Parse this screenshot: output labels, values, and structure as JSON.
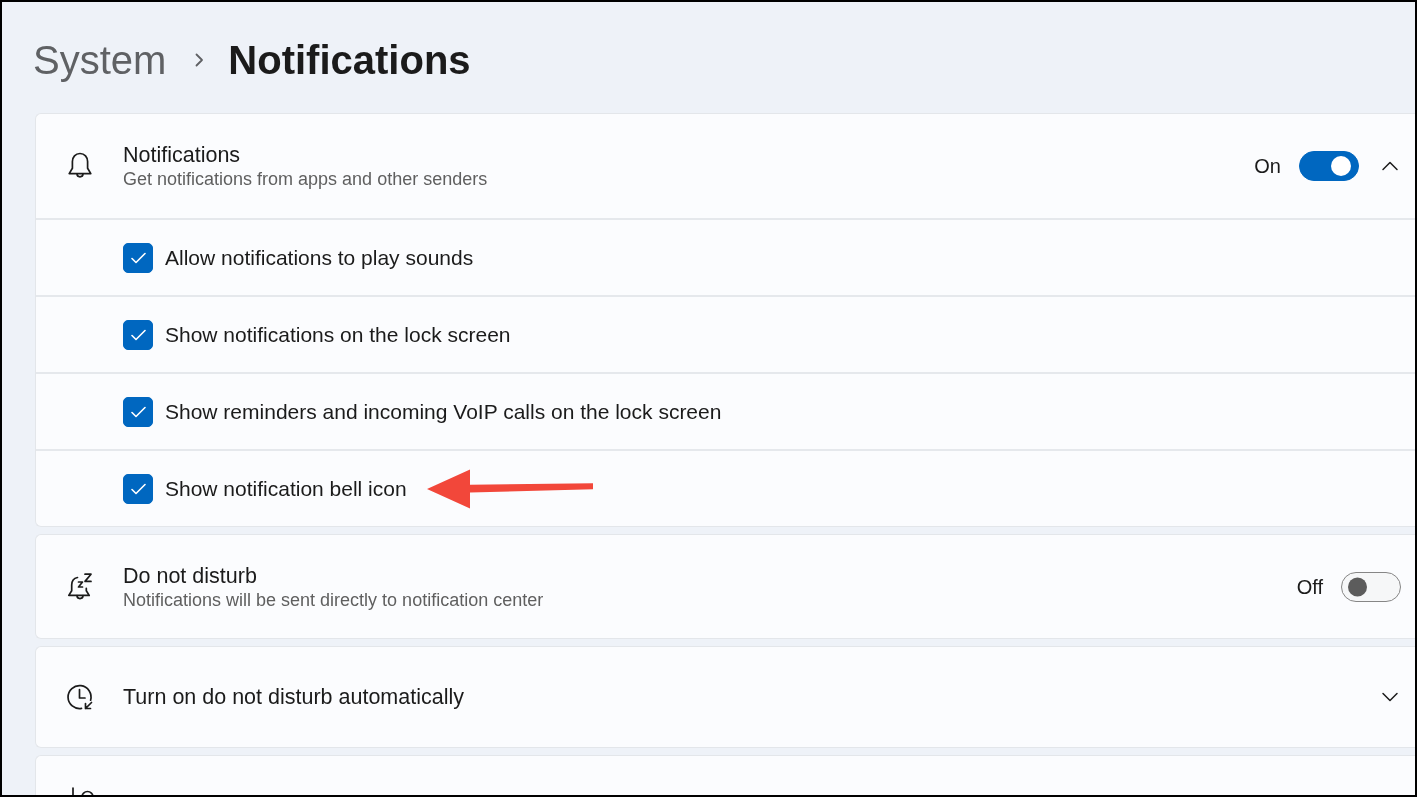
{
  "breadcrumb": [
    {
      "label": "System",
      "current": false
    },
    {
      "label": "Notifications",
      "current": true
    }
  ],
  "settings": [
    {
      "kind": "toggle",
      "title": "Notifications",
      "subtitle": "Get notifications from apps and other senders",
      "state_label": "On",
      "on": true,
      "expanded": true,
      "options": [
        {
          "label": "Allow notifications to play sounds",
          "checked": true,
          "annotated": false
        },
        {
          "label": "Show notifications on the lock screen",
          "checked": true,
          "annotated": false
        },
        {
          "label": "Show reminders and incoming VoIP calls on the lock screen",
          "checked": true,
          "annotated": false
        },
        {
          "label": "Show notification bell icon",
          "checked": true,
          "annotated": true
        }
      ]
    },
    {
      "kind": "toggle",
      "title": "Do not disturb",
      "subtitle": "Notifications will be sent directly to notification center",
      "state_label": "Off",
      "on": false
    },
    {
      "kind": "expander",
      "title": "Turn on do not disturb automatically",
      "expanded": false
    },
    {
      "kind": "cut-off"
    }
  ]
}
